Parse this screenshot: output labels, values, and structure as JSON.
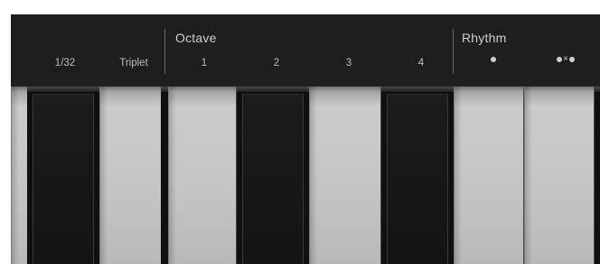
{
  "header": {
    "sections": {
      "octave": "Octave",
      "rhythm": "Rhythm"
    },
    "buttons": {
      "thirty_second": "1/32",
      "triplet": "Triplet",
      "octave_1": "1",
      "octave_2": "2",
      "octave_3": "3",
      "octave_4": "4"
    },
    "rhythm_icons": [
      "dot-icon",
      "dot-x-dot-icon"
    ],
    "rhythm_x": "×"
  },
  "colors": {
    "panel": "#1e1e1e",
    "label": "#cfcfcf",
    "white_key": "#c4c4c4",
    "black_key": "#141414"
  }
}
